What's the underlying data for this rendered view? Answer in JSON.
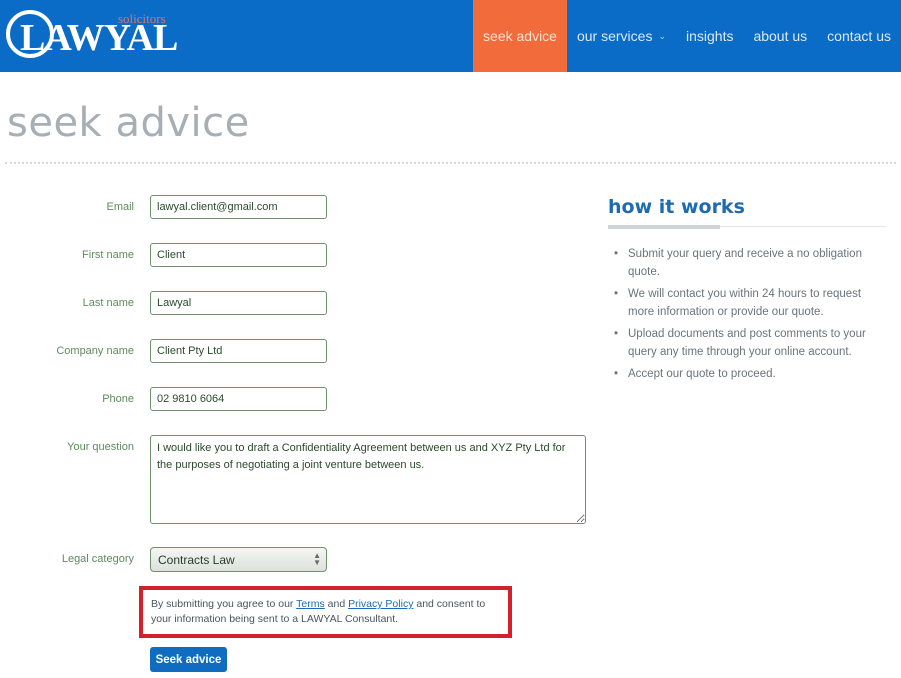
{
  "header": {
    "logo": {
      "main": "LAWYAL",
      "sub": "solicitors"
    },
    "nav": [
      {
        "label": "seek advice",
        "active": true
      },
      {
        "label": "our services",
        "has_dropdown": true,
        "chevron": "⌄"
      },
      {
        "label": "insights"
      },
      {
        "label": "about us"
      },
      {
        "label": "contact us"
      }
    ],
    "colors": {
      "bar": "#0a6cc6",
      "active": "#f26b3a"
    }
  },
  "page": {
    "title": "seek advice"
  },
  "form": {
    "fields": [
      {
        "label": "Email",
        "value": "lawyal.client@gmail.com"
      },
      {
        "label": "First name",
        "value": "Client"
      },
      {
        "label": "Last name",
        "value": "Lawyal"
      },
      {
        "label": "Company name",
        "value": "Client Pty Ltd"
      },
      {
        "label": "Phone",
        "value": "02 9810 6064"
      }
    ],
    "question": {
      "label": "Your question",
      "value": "I would like you to draft a Confidentiality Agreement between us and XYZ Pty Ltd for the purposes of negotiating a joint venture between us."
    },
    "category": {
      "label": "Legal category",
      "selected": "Contracts Law"
    },
    "consent": {
      "before": "By submitting you agree to our ",
      "terms_link": "Terms",
      "middle": " and ",
      "privacy_link": "Privacy Policy",
      "after": " and consent to your information being sent to a LAWYAL Consultant.",
      "highlight_color": "#d4202a"
    },
    "submit_label": "Seek advice"
  },
  "sidebar": {
    "title": "how it works",
    "items": [
      "Submit your query and receive a no obligation quote.",
      "We will contact you within 24 hours to request more information or provide our quote.",
      "Upload documents and post comments to your query any time through your online account.",
      "Accept our quote to proceed."
    ]
  }
}
